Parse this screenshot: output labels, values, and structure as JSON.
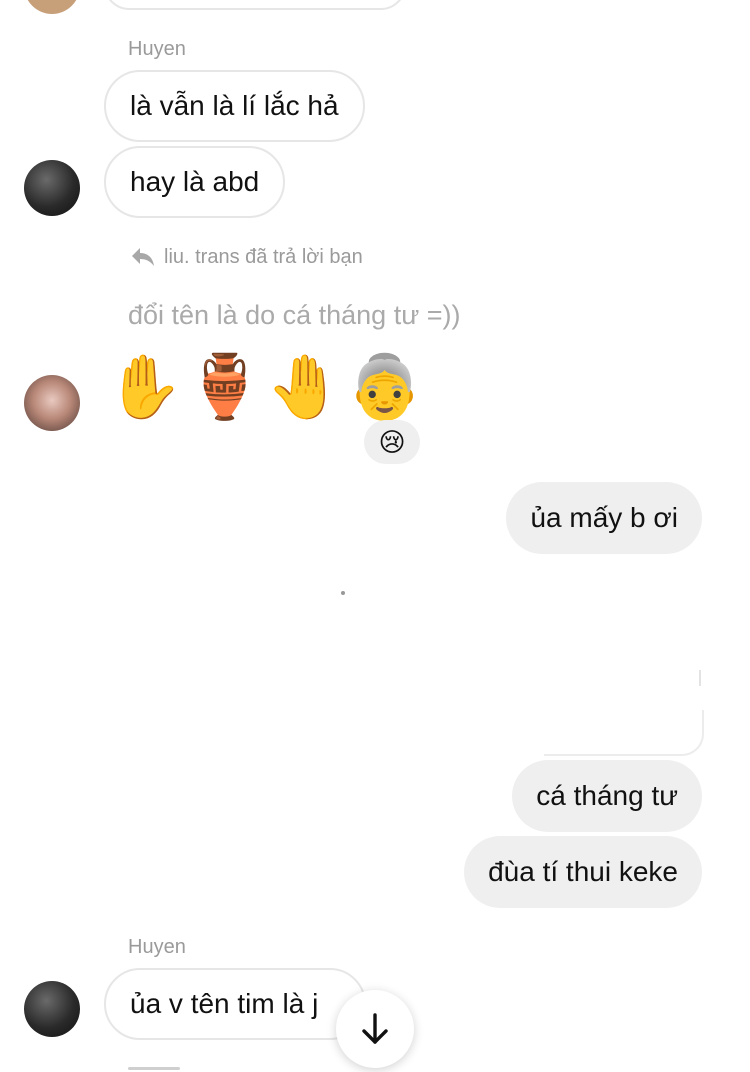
{
  "thread": {
    "top_partial_avatar": "avatar",
    "group1": {
      "sender": "Huyen",
      "messages": [
        "là vẫn là lí lắc hả",
        "hay là abd"
      ]
    },
    "reply": {
      "note": "liu. trans đã trả lời bạn",
      "quoted_text": "đổi tên là do cá tháng tư =))",
      "emojis": [
        "✋",
        "🏺",
        "🤚",
        "👵"
      ],
      "reaction": "😢"
    },
    "outgoing": {
      "messages": [
        "ủa mấy b ơi",
        "cá tháng tư",
        "đùa tí thui keke"
      ]
    },
    "group2": {
      "sender": "Huyen",
      "messages": [
        "ủa v tên tim là j"
      ]
    }
  },
  "icons": {
    "reply": "reply-arrow-icon",
    "scroll_down": "arrow-down-icon"
  },
  "colors": {
    "incoming_border": "#e6e6e6",
    "outgoing_bg": "#efefef",
    "meta_text": "#9a9a9a"
  }
}
